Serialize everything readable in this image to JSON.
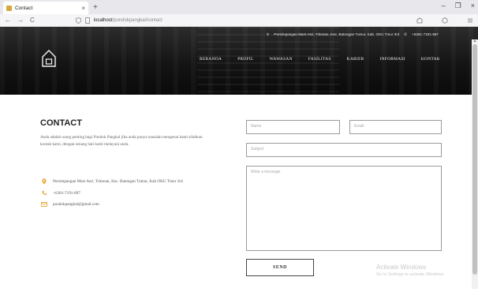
{
  "browser": {
    "tab_title": "Contact",
    "tab_close": "×",
    "new_tab": "+",
    "window_controls": [
      "–",
      "❐",
      "×"
    ],
    "nav_back": "←",
    "nav_forward": "→",
    "nav_reload": "C",
    "url_host": "localhost",
    "url_path": "/pondokpangkal/contact",
    "icons": [
      "back-icon",
      "forward-icon",
      "reload-icon",
      "shield-icon",
      "page-icon",
      "extension-icon",
      "profile-icon",
      "menu-icon"
    ]
  },
  "site": {
    "topinfo_address": "Persimpangan Mars Asri, Tritonan, Kec. Batongan Tumur, Kab. OKU Tmur 3rd",
    "topinfo_phone": "+6281-7191-897",
    "nav": [
      "BERANDA",
      "PROFIL",
      "WAWASAN",
      "FASILITAS",
      "KARIER",
      "INFORMASI",
      "KONTAK"
    ]
  },
  "contact": {
    "heading": "CONTACT",
    "description": "Anda adalah orang penting bagi Pondok Pangkal jika anda punya masalah mengenai kami silahkan kontak kami, dengan senang hati kami melayani anda.",
    "address": "Persimpangan Mars Asri, Tritonan, Kec. Batongan Tumur, Kab OKU Tmur 3rd",
    "phone": "+6281-7191-897",
    "email": "pondokpangkal@gmail.com",
    "icon_address": "location-pin-icon",
    "icon_phone": "phone-icon",
    "icon_email": "email-icon"
  },
  "form": {
    "name_placeholder": "Name",
    "email_placeholder": "Email",
    "subject_placeholder": "Subject",
    "message_placeholder": "Write a message",
    "send_label": "SEND"
  },
  "watermark": {
    "line1": "Activate Windows",
    "line2": "Go to Settings to activate Windows."
  },
  "colors": {
    "accent_icon": "#e8a838",
    "header_bg": "#141414"
  }
}
